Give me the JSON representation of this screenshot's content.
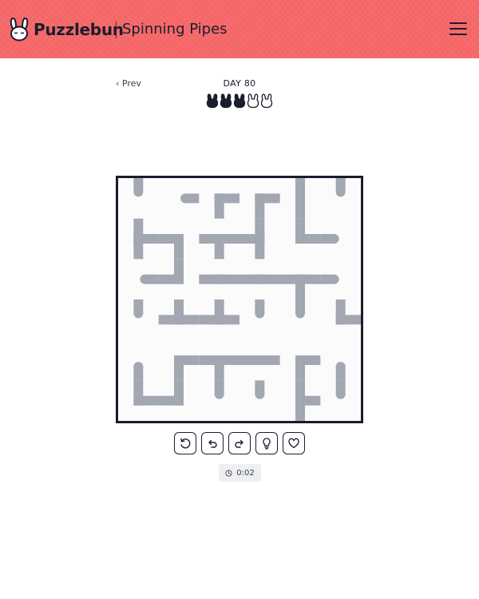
{
  "header": {
    "brand": "Puzzlebun",
    "game_title": "Spinning Pipes",
    "background_color": "#f46566",
    "icons": {
      "logo": "bunny-logo-icon",
      "menu": "hamburger-menu-icon"
    }
  },
  "nav": {
    "prev_label": "‹ Prev",
    "day_label": "DAY 80"
  },
  "difficulty": {
    "level": 3,
    "max": 5,
    "icon": "bunny-head-icon"
  },
  "board": {
    "rows": 6,
    "cols": 6,
    "pipe_color": "#a2a7b2",
    "border_color": "#1a1d2e",
    "tiles": [
      [
        "N",
        "E",
        "SE",
        "SE",
        "NS",
        "N"
      ],
      [
        "NES",
        "SW",
        "SEW",
        "NSW",
        "NE",
        "W"
      ],
      [
        "E",
        "NW",
        "EW",
        "EW",
        "ESW",
        "W"
      ],
      [
        "N",
        "NEW",
        "NEW",
        "N",
        "N",
        "NE"
      ],
      [
        "S",
        "SE",
        "SEW",
        "EW",
        "ES",
        "S"
      ],
      [
        "NE",
        "NW",
        "N",
        "N",
        "NES",
        "N"
      ]
    ]
  },
  "controls": [
    {
      "name": "restart-button",
      "icon": "restart-icon"
    },
    {
      "name": "undo-button",
      "icon": "undo-icon"
    },
    {
      "name": "redo-button",
      "icon": "redo-icon"
    },
    {
      "name": "hint-button",
      "icon": "lightbulb-icon"
    },
    {
      "name": "favorite-button",
      "icon": "heart-icon"
    }
  ],
  "timer": {
    "value": "0:02",
    "icon": "clock-icon"
  }
}
